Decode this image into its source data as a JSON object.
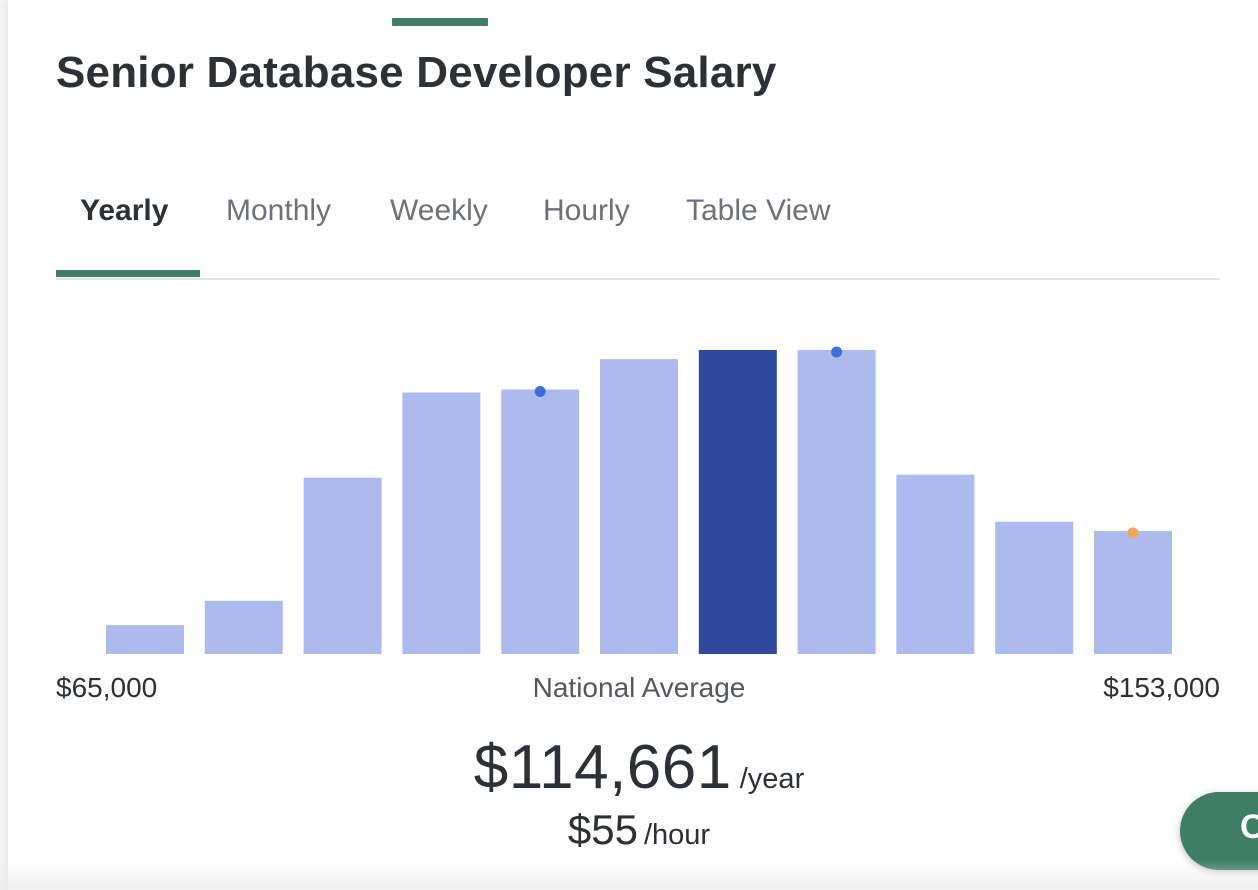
{
  "title": "Senior Database Developer Salary",
  "tabs": [
    {
      "label": "Yearly",
      "active": true
    },
    {
      "label": "Monthly",
      "active": false
    },
    {
      "label": "Weekly",
      "active": false
    },
    {
      "label": "Hourly",
      "active": false
    },
    {
      "label": "Table View",
      "active": false
    }
  ],
  "range": {
    "min_label": "$65,000",
    "max_label": "$153,000",
    "center_label": "National Average"
  },
  "average": {
    "yearly_value": "$114,661",
    "yearly_unit": "/year",
    "hourly_value": "$55",
    "hourly_unit": "/hour"
  },
  "chat_button_label": "C",
  "colors": {
    "accent": "#3f7d67",
    "bar": "#adbaed",
    "bar_highlight": "#2f479c",
    "marker_blue": "#3a6fdc",
    "marker_orange": "#f0aa55"
  },
  "chart_data": {
    "type": "bar",
    "bins": 11,
    "values": [
      9.5,
      17.5,
      58,
      86,
      87,
      97,
      100,
      100,
      59,
      43.5,
      40.5
    ],
    "highlight_index": 6,
    "markers": [
      {
        "bin": 4,
        "value": 87,
        "color": "blue"
      },
      {
        "bin": 7,
        "value": 100,
        "color": "blue"
      },
      {
        "bin": 10,
        "value": 40.5,
        "color": "orange"
      }
    ],
    "ylim": [
      0,
      100
    ],
    "x_range_labels": [
      "$65,000",
      "$153,000"
    ]
  }
}
